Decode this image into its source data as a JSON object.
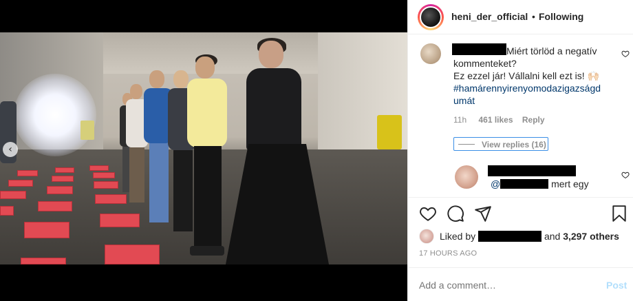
{
  "header": {
    "username": "heni_der_official",
    "separator": "•",
    "follow_status": "Following"
  },
  "comment": {
    "line1": "Miért törlöd a negatív",
    "line2": "kommenteket?",
    "line3": "Ez ezzel jár! Vállalni kell ezt is! 🙌🏻",
    "hashtag_line1": "#hamárennyirenyomodazigazságd",
    "hashtag_line2": "umát",
    "age": "11h",
    "likes": "461 likes",
    "reply_label": "Reply",
    "view_replies": "View replies (16)"
  },
  "reply": {
    "mention": "@",
    "text": "mert egy"
  },
  "likes_line": {
    "prefix": "Liked by",
    "conjunction": "and",
    "others": "3,297 others"
  },
  "timestamp": "17 HOURS AGO",
  "composer": {
    "placeholder": "Add a comment…",
    "post_label": "Post"
  },
  "media": {
    "nav_prev_icon": "‹"
  },
  "icons": {
    "like": "heart-icon",
    "comment": "comment-bubble-icon",
    "share": "paper-plane-icon",
    "save": "bookmark-icon"
  },
  "colors": {
    "link": "#00376b",
    "muted": "#8e8e8e",
    "post_disabled": "#b2dffc"
  }
}
